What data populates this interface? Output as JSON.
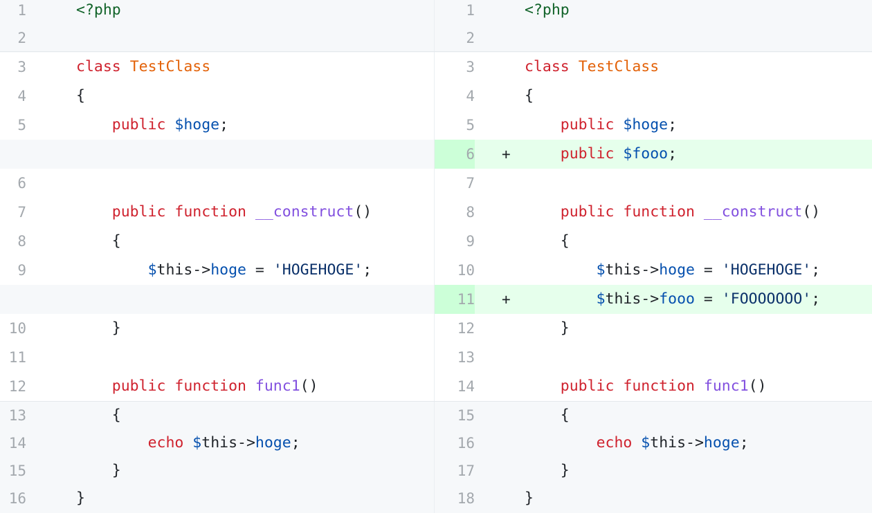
{
  "left": {
    "rows": [
      {
        "num": "1",
        "kind": "ctx",
        "tokens": [
          {
            "t": "<?php",
            "c": "tag"
          }
        ]
      },
      {
        "num": "2",
        "kind": "ctx",
        "tokens": []
      },
      {
        "num": "3",
        "kind": "normal",
        "tokens": [
          {
            "t": "class",
            "c": "kw"
          },
          {
            "t": " ",
            "c": "plain"
          },
          {
            "t": "TestClass",
            "c": "cls"
          }
        ]
      },
      {
        "num": "4",
        "kind": "normal",
        "tokens": [
          {
            "t": "{",
            "c": "plain"
          }
        ]
      },
      {
        "num": "5",
        "kind": "normal",
        "tokens": [
          {
            "t": "    ",
            "c": "plain"
          },
          {
            "t": "public",
            "c": "kw"
          },
          {
            "t": " ",
            "c": "plain"
          },
          {
            "t": "$hoge",
            "c": "var"
          },
          {
            "t": ";",
            "c": "plain"
          }
        ]
      },
      {
        "num": "",
        "kind": "empty",
        "tokens": []
      },
      {
        "num": "6",
        "kind": "normal",
        "tokens": []
      },
      {
        "num": "7",
        "kind": "normal",
        "tokens": [
          {
            "t": "    ",
            "c": "plain"
          },
          {
            "t": "public",
            "c": "kw"
          },
          {
            "t": " ",
            "c": "plain"
          },
          {
            "t": "function",
            "c": "kw"
          },
          {
            "t": " ",
            "c": "plain"
          },
          {
            "t": "__construct",
            "c": "fn"
          },
          {
            "t": "()",
            "c": "plain"
          }
        ]
      },
      {
        "num": "8",
        "kind": "normal",
        "tokens": [
          {
            "t": "    {",
            "c": "plain"
          }
        ]
      },
      {
        "num": "9",
        "kind": "normal",
        "tokens": [
          {
            "t": "        ",
            "c": "plain"
          },
          {
            "t": "$",
            "c": "var"
          },
          {
            "t": "this->",
            "c": "plain"
          },
          {
            "t": "hoge",
            "c": "var"
          },
          {
            "t": " = ",
            "c": "plain"
          },
          {
            "t": "'HOGEHOGE'",
            "c": "str"
          },
          {
            "t": ";",
            "c": "plain"
          }
        ]
      },
      {
        "num": "",
        "kind": "empty",
        "tokens": []
      },
      {
        "num": "10",
        "kind": "normal",
        "tokens": [
          {
            "t": "    }",
            "c": "plain"
          }
        ]
      },
      {
        "num": "11",
        "kind": "normal",
        "tokens": []
      },
      {
        "num": "12",
        "kind": "normal",
        "tokens": [
          {
            "t": "    ",
            "c": "plain"
          },
          {
            "t": "public",
            "c": "kw"
          },
          {
            "t": " ",
            "c": "plain"
          },
          {
            "t": "function",
            "c": "kw"
          },
          {
            "t": " ",
            "c": "plain"
          },
          {
            "t": "func1",
            "c": "fn"
          },
          {
            "t": "()",
            "c": "plain"
          }
        ]
      },
      {
        "num": "13",
        "kind": "ctx",
        "tokens": [
          {
            "t": "    {",
            "c": "plain"
          }
        ]
      },
      {
        "num": "14",
        "kind": "ctx",
        "tokens": [
          {
            "t": "        ",
            "c": "plain"
          },
          {
            "t": "echo",
            "c": "kw"
          },
          {
            "t": " ",
            "c": "plain"
          },
          {
            "t": "$",
            "c": "var"
          },
          {
            "t": "this->",
            "c": "plain"
          },
          {
            "t": "hoge",
            "c": "var"
          },
          {
            "t": ";",
            "c": "plain"
          }
        ]
      },
      {
        "num": "15",
        "kind": "ctx",
        "tokens": [
          {
            "t": "    }",
            "c": "plain"
          }
        ]
      },
      {
        "num": "16",
        "kind": "ctx",
        "tokens": [
          {
            "t": "}",
            "c": "plain"
          }
        ]
      }
    ]
  },
  "right": {
    "rows": [
      {
        "num": "1",
        "kind": "ctx",
        "marker": "",
        "tokens": [
          {
            "t": "<?php",
            "c": "tag"
          }
        ]
      },
      {
        "num": "2",
        "kind": "ctx",
        "marker": "",
        "tokens": []
      },
      {
        "num": "3",
        "kind": "normal",
        "marker": "",
        "tokens": [
          {
            "t": "class",
            "c": "kw"
          },
          {
            "t": " ",
            "c": "plain"
          },
          {
            "t": "TestClass",
            "c": "cls"
          }
        ]
      },
      {
        "num": "4",
        "kind": "normal",
        "marker": "",
        "tokens": [
          {
            "t": "{",
            "c": "plain"
          }
        ]
      },
      {
        "num": "5",
        "kind": "normal",
        "marker": "",
        "tokens": [
          {
            "t": "    ",
            "c": "plain"
          },
          {
            "t": "public",
            "c": "kw"
          },
          {
            "t": " ",
            "c": "plain"
          },
          {
            "t": "$hoge",
            "c": "var"
          },
          {
            "t": ";",
            "c": "plain"
          }
        ]
      },
      {
        "num": "6",
        "kind": "add",
        "marker": "+",
        "tokens": [
          {
            "t": "    ",
            "c": "plain"
          },
          {
            "t": "public",
            "c": "kw"
          },
          {
            "t": " ",
            "c": "plain"
          },
          {
            "t": "$fooo",
            "c": "var"
          },
          {
            "t": ";",
            "c": "plain"
          }
        ]
      },
      {
        "num": "7",
        "kind": "normal",
        "marker": "",
        "tokens": []
      },
      {
        "num": "8",
        "kind": "normal",
        "marker": "",
        "tokens": [
          {
            "t": "    ",
            "c": "plain"
          },
          {
            "t": "public",
            "c": "kw"
          },
          {
            "t": " ",
            "c": "plain"
          },
          {
            "t": "function",
            "c": "kw"
          },
          {
            "t": " ",
            "c": "plain"
          },
          {
            "t": "__construct",
            "c": "fn"
          },
          {
            "t": "()",
            "c": "plain"
          }
        ]
      },
      {
        "num": "9",
        "kind": "normal",
        "marker": "",
        "tokens": [
          {
            "t": "    {",
            "c": "plain"
          }
        ]
      },
      {
        "num": "10",
        "kind": "normal",
        "marker": "",
        "tokens": [
          {
            "t": "        ",
            "c": "plain"
          },
          {
            "t": "$",
            "c": "var"
          },
          {
            "t": "this->",
            "c": "plain"
          },
          {
            "t": "hoge",
            "c": "var"
          },
          {
            "t": " = ",
            "c": "plain"
          },
          {
            "t": "'HOGEHOGE'",
            "c": "str"
          },
          {
            "t": ";",
            "c": "plain"
          }
        ]
      },
      {
        "num": "11",
        "kind": "add",
        "marker": "+",
        "tokens": [
          {
            "t": "        ",
            "c": "plain"
          },
          {
            "t": "$",
            "c": "var"
          },
          {
            "t": "this->",
            "c": "plain"
          },
          {
            "t": "fooo",
            "c": "var"
          },
          {
            "t": " = ",
            "c": "plain"
          },
          {
            "t": "'FOOOOOOO'",
            "c": "str"
          },
          {
            "t": ";",
            "c": "plain"
          }
        ]
      },
      {
        "num": "12",
        "kind": "normal",
        "marker": "",
        "tokens": [
          {
            "t": "    }",
            "c": "plain"
          }
        ]
      },
      {
        "num": "13",
        "kind": "normal",
        "marker": "",
        "tokens": []
      },
      {
        "num": "14",
        "kind": "normal",
        "marker": "",
        "tokens": [
          {
            "t": "    ",
            "c": "plain"
          },
          {
            "t": "public",
            "c": "kw"
          },
          {
            "t": " ",
            "c": "plain"
          },
          {
            "t": "function",
            "c": "kw"
          },
          {
            "t": " ",
            "c": "plain"
          },
          {
            "t": "func1",
            "c": "fn"
          },
          {
            "t": "()",
            "c": "plain"
          }
        ]
      },
      {
        "num": "15",
        "kind": "ctx",
        "marker": "",
        "tokens": [
          {
            "t": "    {",
            "c": "plain"
          }
        ]
      },
      {
        "num": "16",
        "kind": "ctx",
        "marker": "",
        "tokens": [
          {
            "t": "        ",
            "c": "plain"
          },
          {
            "t": "echo",
            "c": "kw"
          },
          {
            "t": " ",
            "c": "plain"
          },
          {
            "t": "$",
            "c": "var"
          },
          {
            "t": "this->",
            "c": "plain"
          },
          {
            "t": "hoge",
            "c": "var"
          },
          {
            "t": ";",
            "c": "plain"
          }
        ]
      },
      {
        "num": "17",
        "kind": "ctx",
        "marker": "",
        "tokens": [
          {
            "t": "    }",
            "c": "plain"
          }
        ]
      },
      {
        "num": "18",
        "kind": "ctx",
        "marker": "",
        "tokens": [
          {
            "t": "}",
            "c": "plain"
          }
        ]
      }
    ]
  },
  "colors": {
    "keyword": "#cf222e",
    "class_name": "#e36209",
    "variable": "#0550ae",
    "function": "#8250df",
    "string": "#0a3069",
    "php_tag": "#116329",
    "added_bg": "#e6ffec",
    "added_gutter": "#ccffd8",
    "context_bg": "#f6f8fa"
  }
}
